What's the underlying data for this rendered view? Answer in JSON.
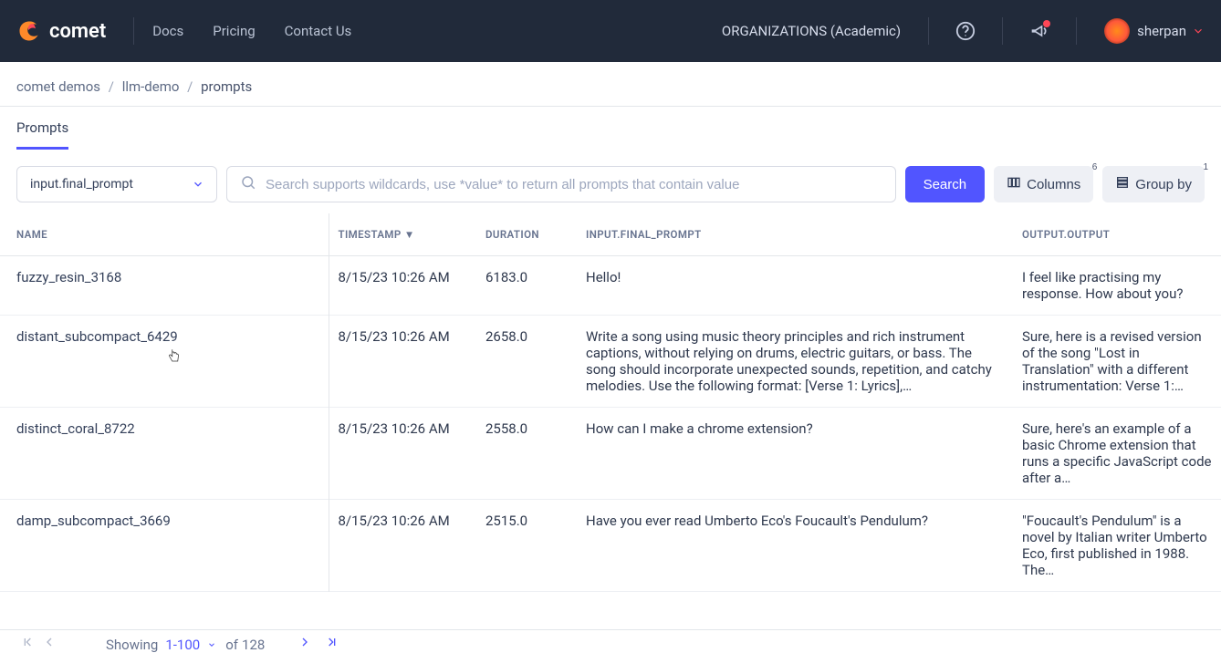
{
  "header": {
    "brand": "comet",
    "nav": [
      "Docs",
      "Pricing",
      "Contact Us"
    ],
    "org_label": "ORGANIZATIONS (Academic)",
    "username": "sherpan"
  },
  "breadcrumbs": {
    "a": "comet demos",
    "b": "llm-demo",
    "c": "prompts"
  },
  "tabs": {
    "active": "Prompts"
  },
  "toolbar": {
    "field_select": "input.final_prompt",
    "search_placeholder": "Search supports wildcards, use *value* to return all prompts that contain value",
    "search_btn": "Search",
    "columns_btn": "Columns",
    "columns_badge": "6",
    "group_btn": "Group by",
    "group_badge": "1"
  },
  "table": {
    "headers": {
      "name": "NAME",
      "timestamp": "TIMESTAMP ▼",
      "duration": "DURATION",
      "input": "INPUT.FINAL_PROMPT",
      "output": "OUTPUT.OUTPUT"
    },
    "rows": [
      {
        "name": "fuzzy_resin_3168",
        "timestamp": "8/15/23 10:26 AM",
        "duration": "6183.0",
        "input": "Hello!",
        "output": "I feel like practising my response. How about you?"
      },
      {
        "name": "distant_subcompact_6429",
        "timestamp": "8/15/23 10:26 AM",
        "duration": "2658.0",
        "input": "Write a song using music theory principles and rich instrument captions, without relying on drums, electric guitars, or bass. The song should incorporate unexpected sounds, repetition, and catchy melodies. Use the following format: [Verse 1: Lyrics],…",
        "output": "Sure, here is a revised version of the song \"Lost in Translation\" with a different instrumentation: Verse 1:…"
      },
      {
        "name": "distinct_coral_8722",
        "timestamp": "8/15/23 10:26 AM",
        "duration": "2558.0",
        "input": "How can I make a chrome extension?",
        "output": "Sure, here's an example of a basic Chrome extension that runs a specific JavaScript code after a…"
      },
      {
        "name": "damp_subcompact_3669",
        "timestamp": "8/15/23 10:26 AM",
        "duration": "2515.0",
        "input": "Have you ever read Umberto Eco's Foucault's Pendulum?",
        "output": "\"Foucault's Pendulum\" is a novel by Italian writer Umberto Eco, first published in 1988. The…"
      }
    ]
  },
  "pagination": {
    "showing_label": "Showing",
    "range": "1-100",
    "of_label": "of",
    "total": "128"
  }
}
